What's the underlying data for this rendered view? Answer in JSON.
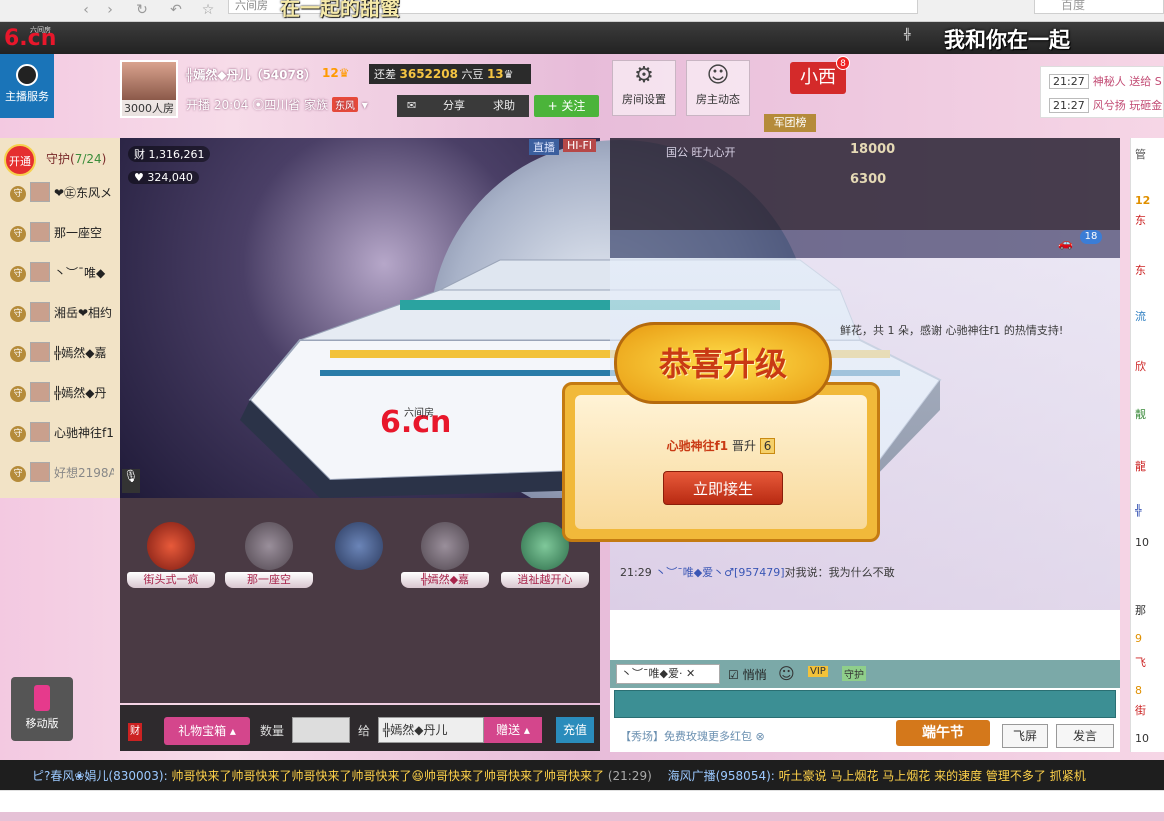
{
  "browser": {
    "address": "六间房",
    "overlay_title": "在一起的甜蜜",
    "search_placeholder": "百度"
  },
  "topbar": {
    "logo": "6.cn",
    "logo_sub": "六间房",
    "user_short": "╬",
    "overlay_right": "我和你在一起"
  },
  "host_service": {
    "label": "主播服务"
  },
  "host": {
    "name": "╬嫣然◆丹儿（54078）",
    "level": "12",
    "room_count": "3000人房",
    "upgrade_label": "还差",
    "upgrade_value": "3652208",
    "upgrade_unit": "六豆",
    "next_level": "13",
    "start_time": "开播 20:04",
    "location": "四川省",
    "clan_label": "家族",
    "clan": "东风"
  },
  "actions": {
    "share": "分享",
    "help": "求助",
    "follow": "+ 关注",
    "room_settings": "房间设置",
    "host_news": "房主动态",
    "xiaoxi": "小西",
    "xiaoxi_badge": "8",
    "army_list": "军团榜"
  },
  "gift_msgs": [
    {
      "time": "21:27",
      "text": "神秘人 送给 S"
    },
    {
      "time": "21:27",
      "text": "风兮扬 玩砸金"
    }
  ],
  "guard": {
    "open": "开通",
    "title": "守护(",
    "count": "7/24",
    "close": ")",
    "tag": "守",
    "members": [
      {
        "name": "❤㊣东风メ"
      },
      {
        "name": "那一座空"
      },
      {
        "name": "丶︶¯唯◆"
      },
      {
        "name": "湘岳❤相约"
      },
      {
        "name": "╬嫣然◆嘉"
      },
      {
        "name": "╬嫣然◆丹"
      },
      {
        "name": "心驰神往f1"
      },
      {
        "name": "好想2198A"
      }
    ]
  },
  "video": {
    "wealth": "1,316,261",
    "fans": "324,040",
    "live": "直播",
    "hifi": "HI-FI",
    "watermark": "6.cn",
    "watermark_sub": "六间房"
  },
  "seats": [
    {
      "name": "街头式一疯"
    },
    {
      "name": "那一座空"
    },
    {
      "name": ""
    },
    {
      "name": "╬嫣然◆嘉"
    },
    {
      "name": "逍祉越开心"
    }
  ],
  "gift_bar": {
    "cai": "财",
    "giftbox": "礼物宝箱",
    "qty": "数量",
    "give": "给",
    "recipient": "╬嫣然◆丹儿",
    "send": "赠送",
    "recharge": "充值"
  },
  "rank": [
    {
      "tag": "国公",
      "name": "旺九心开",
      "value": "18000"
    },
    {
      "tag": "",
      "name": "",
      "value": "6300"
    }
  ],
  "chat": {
    "car_badge": "18",
    "lines": [
      {
        "pre": "",
        "hl": "",
        "text": "鲜花，共 1 朵，感谢 心驰神往f1 的热情支持!"
      },
      {
        "pre": "21:29",
        "hl": "丶︶¯唯◆爱丶♂[957479]",
        "text": "对我说：我为什么不敢"
      }
    ],
    "to_user": "丶︶¯唯◆爱·",
    "whisper": "悄悄",
    "vip": "VIP",
    "guard_icon": "守护",
    "promo": "【秀场】免费玫瑰更多红包",
    "dragon_fest": "端午节",
    "fly": "飞屏",
    "post": "发言"
  },
  "popup": {
    "title": "恭喜升级",
    "name": "心驰神往f1",
    "promote": "晋升",
    "badge": "6",
    "accept": "立即接生"
  },
  "right_list": [
    "管",
    "12",
    "东",
    "东",
    "流",
    "欣",
    "靓",
    "龍",
    "╬",
    "10",
    "那",
    "9",
    "飞",
    "8",
    "街",
    "10"
  ],
  "mobile": {
    "label": "移动版"
  },
  "marquee": {
    "user1": "ピ?春风❀娟儿(830003):",
    "msg1": "帅哥快来了帅哥快来了帅哥快来了帅哥快来了😆帅哥快来了帅哥快来了帅哥快来了",
    "time1": "(21:29)",
    "user2": "海风广播(958054):",
    "msg2": "听土豪说 马上烟花 马上烟花 来的速度 管理不多了 抓紧机"
  },
  "colors": {
    "accent_pink": "#d4468c",
    "follow_green": "#4bb43a",
    "brand_red": "#e8172b"
  }
}
